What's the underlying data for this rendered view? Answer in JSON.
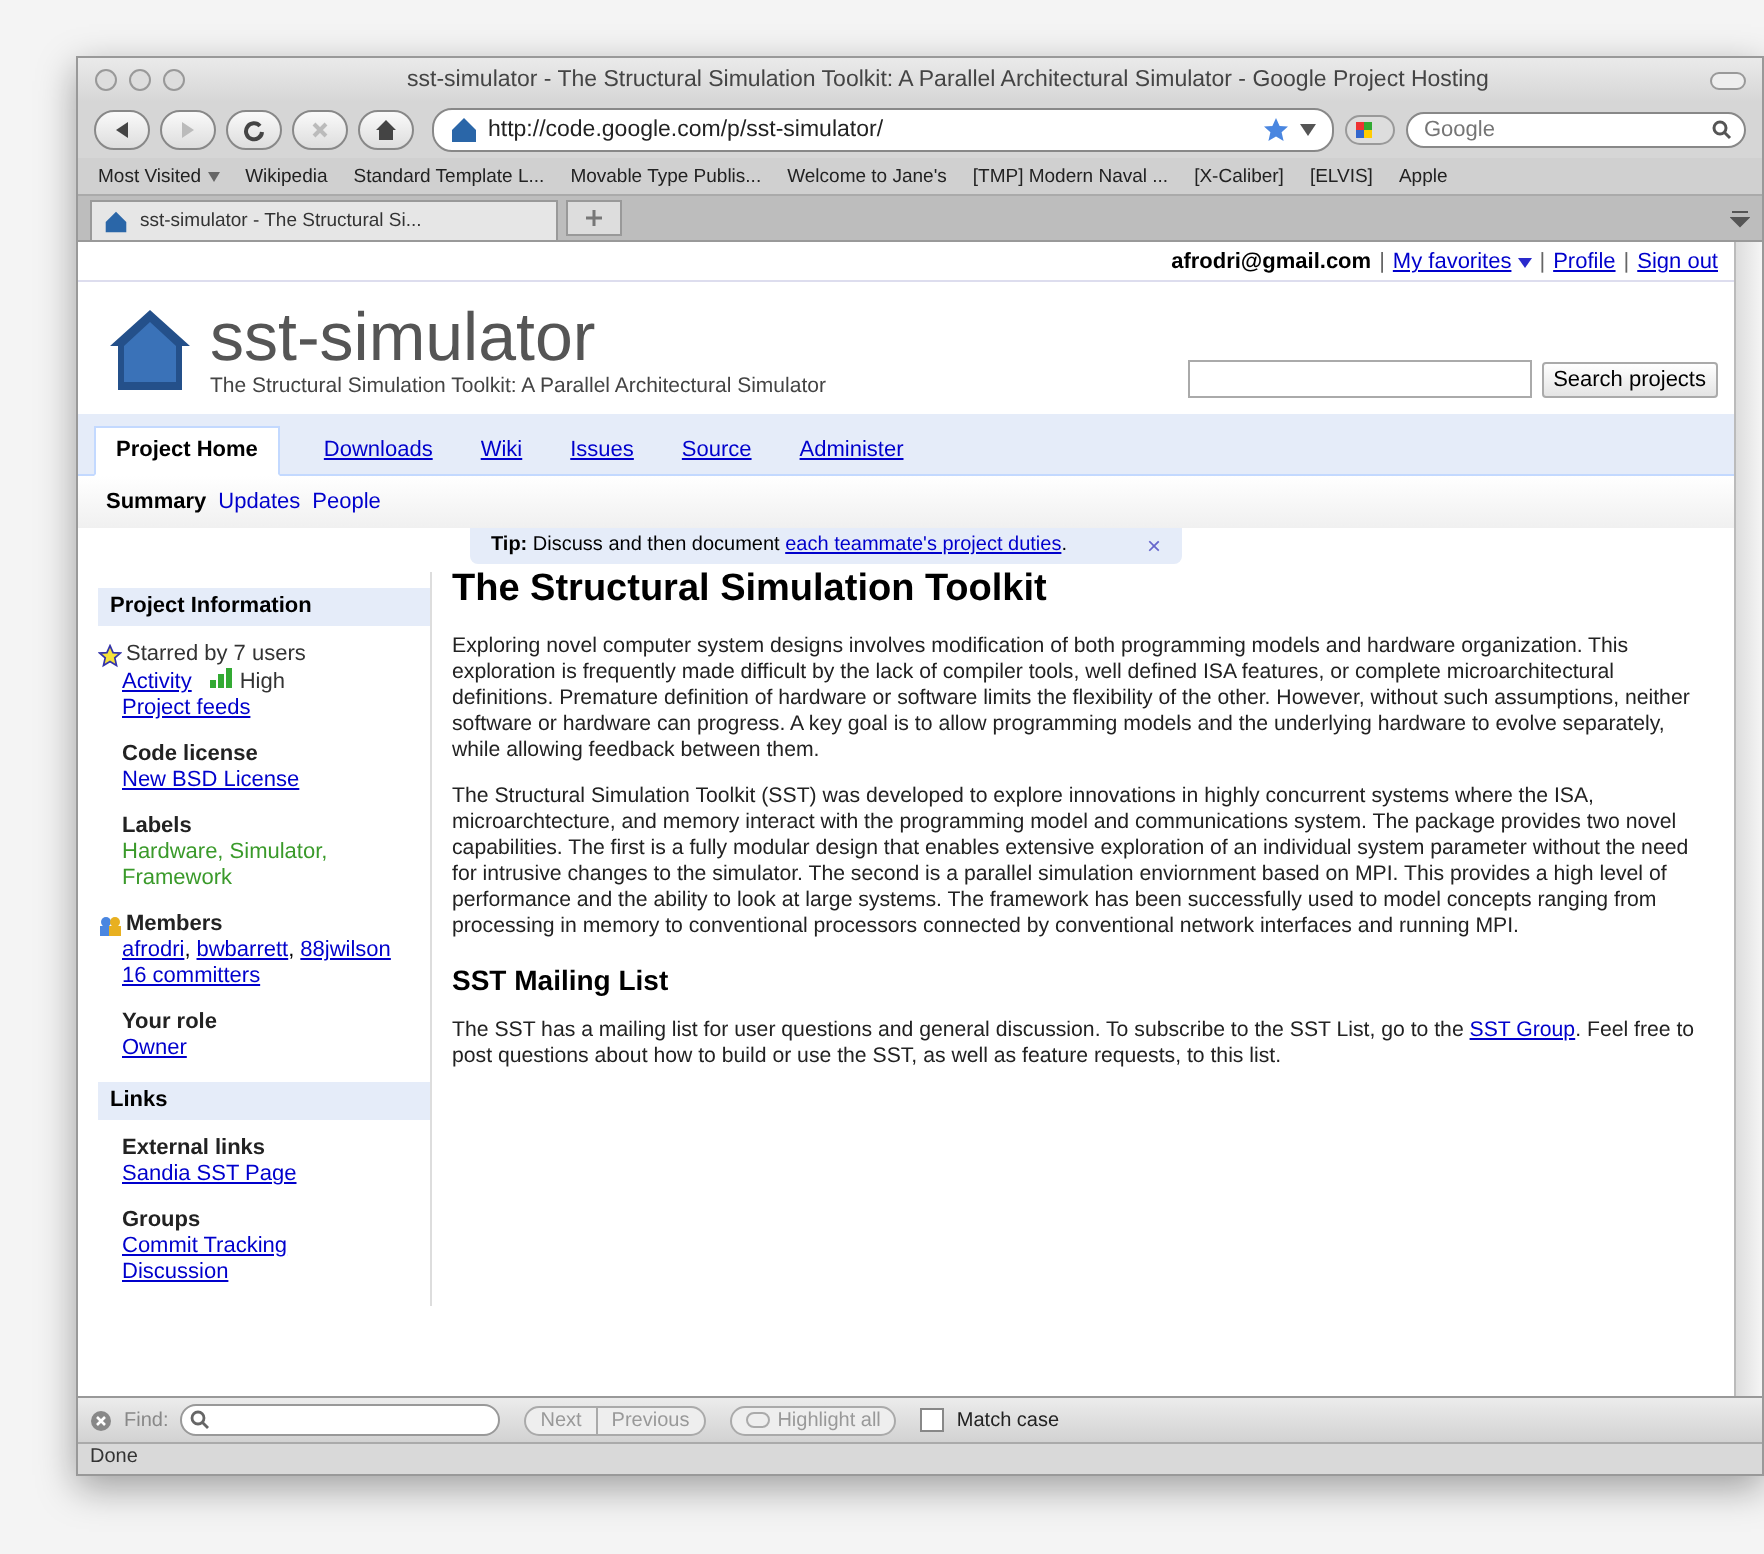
{
  "window": {
    "title": "sst-simulator - The Structural Simulation Toolkit: A Parallel Architectural Simulator - Google Project Hosting"
  },
  "toolbar": {
    "url": "http://code.google.com/p/sst-simulator/",
    "search_placeholder": "Google",
    "buttons": [
      {
        "kind": "back",
        "disabled": false
      },
      {
        "kind": "forward",
        "disabled": true
      },
      {
        "kind": "reload",
        "disabled": false
      },
      {
        "kind": "stop",
        "disabled": true
      },
      {
        "kind": "home",
        "disabled": false
      }
    ]
  },
  "bookmarks": [
    {
      "label": "Most Visited",
      "menu": true
    },
    {
      "label": "Wikipedia",
      "menu": false
    },
    {
      "label": "Standard Template L...",
      "menu": false
    },
    {
      "label": "Movable Type Publis...",
      "menu": false
    },
    {
      "label": "Welcome to Jane's",
      "menu": false
    },
    {
      "label": "[TMP] Modern Naval ...",
      "menu": false
    },
    {
      "label": "[X-Caliber]",
      "menu": false
    },
    {
      "label": "[ELVIS]",
      "menu": false
    },
    {
      "label": "Apple",
      "menu": false
    }
  ],
  "tabs": [
    {
      "label": "sst-simulator - The Structural Si...",
      "selected": true
    }
  ],
  "user_bar": {
    "email": "afrodri@gmail.com",
    "links": [
      {
        "sep": "|",
        "label": "My favorites",
        "menu": true
      },
      {
        "sep": "|",
        "label": "Profile",
        "menu": false
      },
      {
        "sep": "|",
        "label": "Sign out",
        "menu": false
      }
    ]
  },
  "project": {
    "name": "sst-simulator",
    "summary": "The Structural Simulation Toolkit: A Parallel Architectural Simulator",
    "search_button": "Search projects"
  },
  "nav_tabs": [
    {
      "label": "Project Home",
      "selected": true
    },
    {
      "label": "Downloads",
      "selected": false
    },
    {
      "label": "Wiki",
      "selected": false
    },
    {
      "label": "Issues",
      "selected": false
    },
    {
      "label": "Source",
      "selected": false
    },
    {
      "label": "Administer",
      "selected": false
    }
  ],
  "sub_tabs": [
    {
      "label": "Summary",
      "selected": true
    },
    {
      "label": "Updates",
      "selected": false
    },
    {
      "label": "People",
      "selected": false
    }
  ],
  "tip": {
    "text": "**Tip:** Discuss and then document ",
    "link": "each teammate's project duties",
    "tail": ".",
    "close": "×"
  },
  "project_information": {
    "heading": "Project Information",
    "starred": "Starred by 7 users",
    "activity": {
      "link": "Activity",
      "reading": "High"
    },
    "feeds": "Project feeds",
    "code_license": {
      "title": "Code license",
      "link": "New BSD License"
    },
    "labels": {
      "title": "Labels",
      "text": "Hardware, Simulator, Framework"
    },
    "members": {
      "title": "Members",
      "links": [
        {
          "name": "afrodri",
          "sep": ","
        },
        {
          "name": "bwbarrett",
          "sep": ","
        },
        {
          "name": "88jwilson"
        }
      ],
      "committers": "16 committers"
    },
    "role": {
      "title": "Your role",
      "link": "Owner"
    }
  },
  "links": {
    "heading": "Links",
    "groups": [
      {
        "title": "External links",
        "links": [
          "Sandia SST Page"
        ]
      },
      {
        "title": "Groups",
        "links": [
          "Commit Tracking",
          "Discussion"
        ]
      }
    ]
  },
  "main": {
    "title": "The Structural Simulation Toolkit",
    "paragraphs": [
      "Exploring novel computer system designs involves modification of both programming models and hardware organization. This exploration is frequently made difficult by the lack of compiler tools, well defined ISA features, or complete microarchitectural definitions. Premature definition of hardware or software limits the flexibility of the other. However, without such assumptions, neither software or hardware can progress. A key goal is to allow programming models and the underlying hardware to evolve separately, while allowing feedback between them.",
      "The Structural Simulation Toolkit (SST) was developed to explore innovations in highly concurrent systems where the ISA, microarchtecture, and memory interact with the programming model and communications system. The package provides two novel capabilities. The first is a fully modular design that enables extensive exploration of an individual system parameter without the need for intrusive changes to the simulator. The second is a parallel simulation enviornment based on MPI. This provides a high level of performance and the ability to look at large systems. The framework has been successfully used to model concepts ranging from processing in memory to conventional processors connected by conventional network interfaces and running MPI."
    ],
    "subtitle": "SST Mailing List",
    "mailing": {
      "text": "The SST has a mailing list for user questions and general discussion. To subscribe to the SST List, go to the ",
      "link": "SST Group",
      "tail": ". Feel free to post questions about how to build or use the SST, as well as feature requests, to this list."
    }
  },
  "find_bar": {
    "label": "Find:",
    "buttons": [
      {
        "label": "Next",
        "disabled": true
      },
      {
        "label": "Previous",
        "disabled": true
      }
    ],
    "highlight": {
      "label": "Highlight all",
      "disabled": true
    },
    "match_case": {
      "label": "Match case",
      "checked": false
    }
  },
  "status_bar": "Done"
}
